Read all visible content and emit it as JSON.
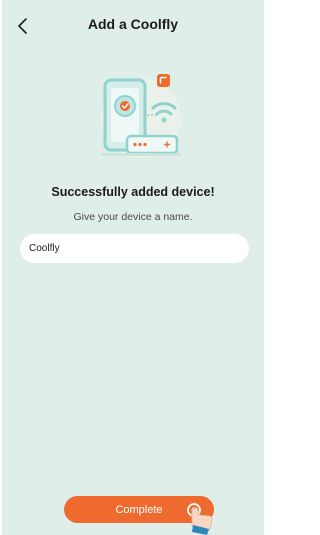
{
  "header": {
    "title": "Add a Coolfly"
  },
  "illustration": {
    "icon": "phone-router-wifi-illustration"
  },
  "main": {
    "success_title": "Successfully added device!",
    "subtitle": "Give your device a name.",
    "name_field": {
      "value": "Coolfly",
      "placeholder": ""
    }
  },
  "footer": {
    "complete_label": "Complete"
  },
  "colors": {
    "background": "#dfeee8",
    "accent": "#ee6a2e",
    "illustration_teal": "#8fd3cc"
  }
}
